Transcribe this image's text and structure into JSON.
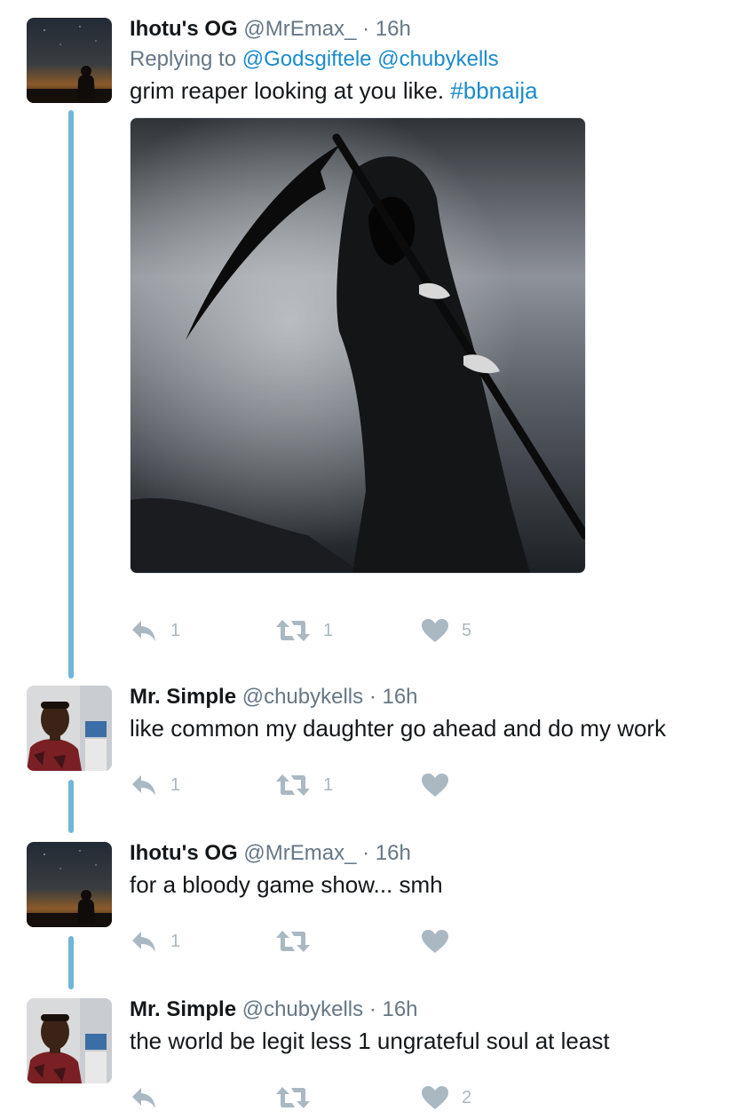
{
  "tweets": [
    {
      "name": "Ihotu's OG",
      "handle": "@MrEmax_",
      "time": "16h",
      "reply_prefix": "Replying to ",
      "reply_mentions": [
        "@Godsgiftele",
        "@chubykells"
      ],
      "text": "grim reaper looking at you like. ",
      "hashtag": "#bbnaija",
      "replies": "1",
      "retweets": "1",
      "likes": "5",
      "avatar": "silhouette-night-sky",
      "media": "grim-reaper-with-scythe"
    },
    {
      "name": "Mr. Simple",
      "handle": "@chubykells",
      "time": "16h",
      "text": "like common my daughter go ahead and do my work",
      "replies": "1",
      "retweets": "1",
      "likes": "",
      "avatar": "man-portrait"
    },
    {
      "name": "Ihotu's OG",
      "handle": "@MrEmax_",
      "time": "16h",
      "text": "for a bloody game show... smh",
      "replies": "1",
      "retweets": "",
      "likes": "",
      "avatar": "silhouette-night-sky"
    },
    {
      "name": "Mr. Simple",
      "handle": "@chubykells",
      "time": "16h",
      "text": "the world be legit less 1 ungrateful soul at least",
      "replies": "",
      "retweets": "",
      "likes": "2",
      "avatar": "man-portrait"
    }
  ],
  "separator": "·",
  "icons": {
    "reply": "reply-arrow-icon",
    "retweet": "retweet-icon",
    "like": "heart-icon"
  },
  "colors": {
    "link": "#1b8bcc",
    "thread_line": "#6fb6d8",
    "muted": "#657786",
    "action_icon": "#aab8c2"
  }
}
